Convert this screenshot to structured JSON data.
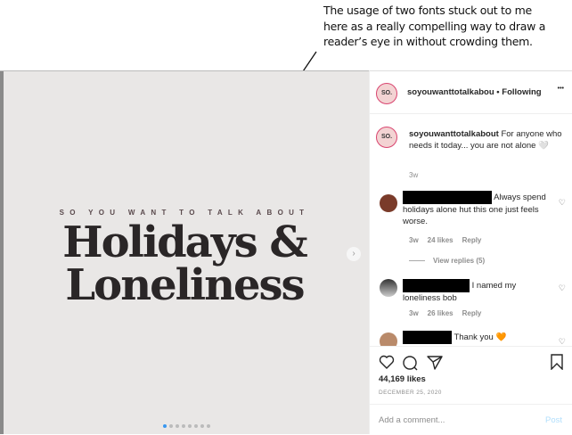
{
  "annotation": "The usage  of two fonts stuck out to me here as a really compelling way to draw a reader’s eye in without crowding them.",
  "image": {
    "kicker": "SO YOU WANT TO TALK ABOUT",
    "title_line1": "Holidays &",
    "title_line2": "Loneliness",
    "slide_count": 8,
    "active_slide": 1
  },
  "header": {
    "avatar_text": "SO.",
    "username": "soyouwanttotalkabou",
    "following": "• Following",
    "more": "•••"
  },
  "caption": {
    "username": "soyouwanttotalkabout",
    "text": "For anyone who needs it today... you are not alone 🤍",
    "time": "3w"
  },
  "comments": [
    {
      "text": "Always spend holidays alone hut this one just feels worse.",
      "time": "3w",
      "likes": "24 likes",
      "reply": "Reply",
      "view_replies": "View replies (5)"
    },
    {
      "text": "I named my loneliness bob",
      "time": "3w",
      "likes": "26 likes",
      "reply": "Reply"
    },
    {
      "text": "Thank you 🧡"
    }
  ],
  "likes": "44,169 likes",
  "date": "DECEMBER 25, 2020",
  "add_comment_placeholder": "Add a comment...",
  "post_label": "Post"
}
